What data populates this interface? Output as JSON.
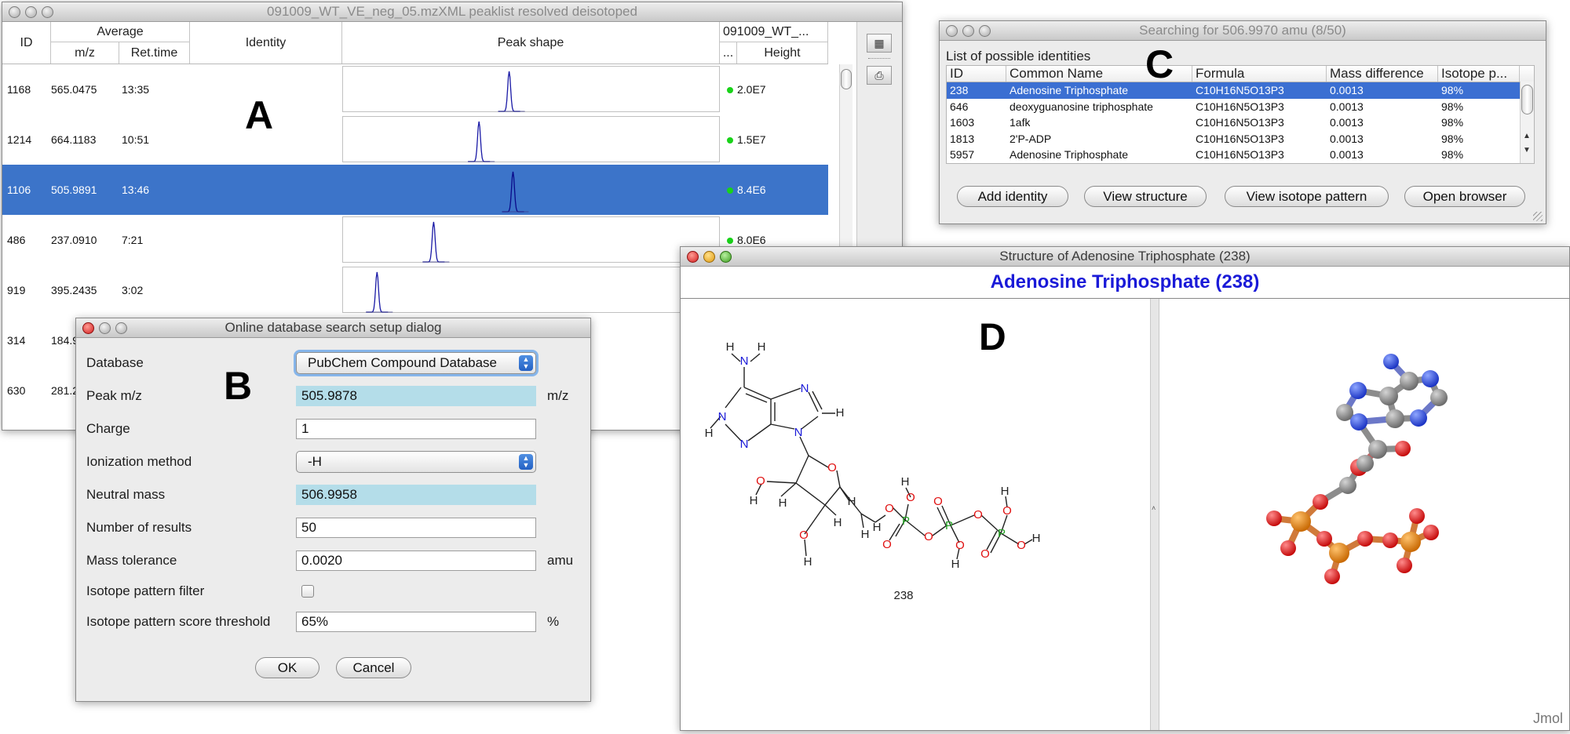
{
  "winA": {
    "title": "091009_WT_VE_neg_05.mzXML peaklist resolved deisotoped",
    "letter": "A",
    "header": {
      "id": "ID",
      "average": "Average",
      "mz": "m/z",
      "rettime": "Ret.time",
      "identity": "Identity",
      "peakshape": "Peak shape",
      "file": "091009_WT_...",
      "file_sub": "...",
      "height": "Height"
    },
    "rows": [
      {
        "id": "1168",
        "mz": "565.0475",
        "rt": "13:35",
        "height": "2.0E7",
        "peak": 0.44
      },
      {
        "id": "1214",
        "mz": "664.1183",
        "rt": "10:51",
        "height": "1.5E7",
        "peak": 0.36
      },
      {
        "id": "1106",
        "mz": "505.9891",
        "rt": "13:46",
        "height": "8.4E6",
        "peak": 0.45
      },
      {
        "id": "486",
        "mz": "237.0910",
        "rt": "7:21",
        "height": "8.0E6",
        "peak": 0.24
      },
      {
        "id": "919",
        "mz": "395.2435",
        "rt": "3:02",
        "height": "",
        "peak": 0.09
      },
      {
        "id": "314",
        "mz": "184.9",
        "rt": "",
        "height": "",
        "peak": null
      },
      {
        "id": "630",
        "mz": "281.2",
        "rt": "",
        "height": "",
        "peak": null
      }
    ],
    "selected_row": 2
  },
  "winB": {
    "title": "Online database search setup dialog",
    "letter": "B",
    "database_label": "Database",
    "database_value": "PubChem Compound Database",
    "peakmz_label": "Peak m/z",
    "peakmz_value": "505.9878",
    "peakmz_unit": "m/z",
    "charge_label": "Charge",
    "charge_value": "1",
    "ionization_label": "Ionization method",
    "ionization_value": "-H",
    "neutral_label": "Neutral mass",
    "neutral_value": "506.9958",
    "nresults_label": "Number of results",
    "nresults_value": "50",
    "tolerance_label": "Mass tolerance",
    "tolerance_value": "0.0020",
    "tolerance_unit": "amu",
    "isofilter_label": "Isotope pattern filter",
    "isothreshold_label": "Isotope pattern score threshold",
    "isothreshold_value": "65%",
    "isothreshold_unit": "%",
    "ok_label": "OK",
    "cancel_label": "Cancel"
  },
  "winC": {
    "title": "Searching for 506.9970 amu (8/50)",
    "letter": "C",
    "list_label": "List of possible identities",
    "headers": [
      "ID",
      "Common Name",
      "Formula",
      "Mass difference",
      "Isotope p..."
    ],
    "rows": [
      [
        "238",
        "Adenosine Triphosphate",
        "C10H16N5O13P3",
        "0.0013",
        "98%"
      ],
      [
        "646",
        "deoxyguanosine triphosphate",
        "C10H16N5O13P3",
        "0.0013",
        "98%"
      ],
      [
        "1603",
        "1afk",
        "C10H16N5O13P3",
        "0.0013",
        "98%"
      ],
      [
        "1813",
        "2'P-ADP",
        "C10H16N5O13P3",
        "0.0013",
        "98%"
      ],
      [
        "5957",
        "Adenosine Triphosphate",
        "C10H16N5O13P3",
        "0.0013",
        "98%"
      ]
    ],
    "selected_row": 0,
    "buttons": {
      "add": "Add identity",
      "structure": "View structure",
      "isotope": "View isotope pattern",
      "browser": "Open browser"
    }
  },
  "winD": {
    "title": "Structure of Adenosine Triphosphate (238)",
    "heading": "Adenosine Triphosphate (238)",
    "letter": "D",
    "compound_id": "238",
    "jmol": "Jmol",
    "atoms": {
      "H": "H",
      "N": "N",
      "O": "O",
      "P": "P"
    }
  },
  "colors": {
    "selection": "#3c74c9",
    "heading_blue": "#1a1ad8",
    "readonly_field": "#b4dde9",
    "oxygen": "#e01010",
    "nitrogen": "#1a1ad8",
    "phosphorus": "#20a020",
    "ball_carbon": "#8c8c8c",
    "ball_nitrogen": "#2f55e0",
    "ball_oxygen": "#ef1c1c",
    "ball_phosphorus": "#f08a10"
  }
}
